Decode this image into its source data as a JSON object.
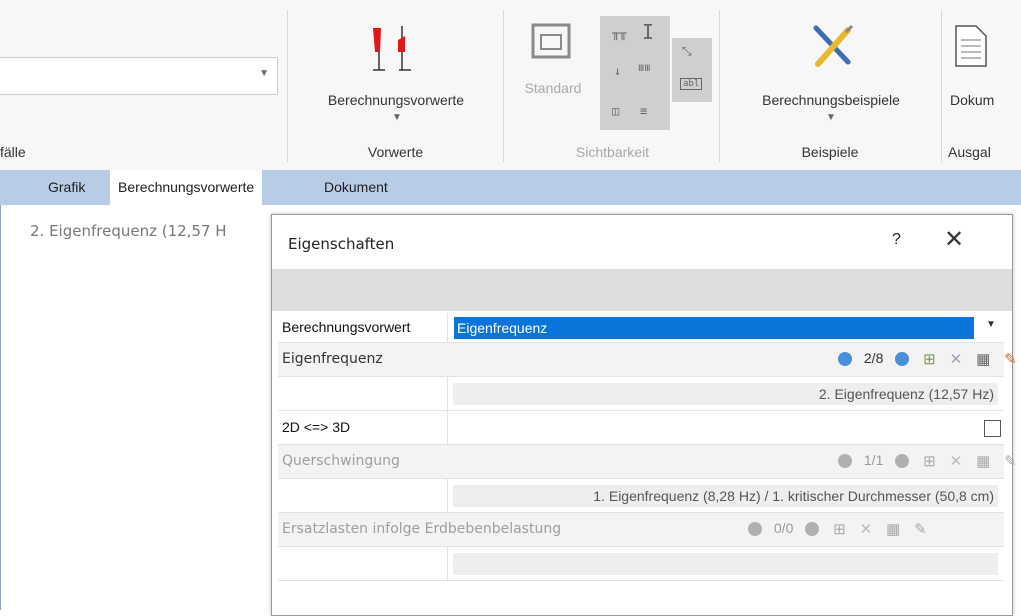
{
  "ribbon": {
    "combo": {
      "value": ""
    },
    "left_group_label": "fälle",
    "berechnungsvorwerte_btn": "Berechnungsvorwerte",
    "vorwerte_label": "Vorwerte",
    "standard_btn": "Standard",
    "sichtbarkeit_label": "Sichtbarkeit",
    "berechnungsbeispiele_btn": "Berechnungsbeispiele",
    "beispiele_label": "Beispiele",
    "dokument_btn": "Dokum",
    "ausgabe_label": "Ausgal",
    "colors": {
      "flag_red": "#e01818",
      "accent_bar": "#b9cce6"
    }
  },
  "tabs": [
    {
      "label": "Grafik",
      "active": false
    },
    {
      "label": "Berechnungsvorwerte",
      "active": true
    },
    {
      "label": "Dokument",
      "active": false
    }
  ],
  "content": {
    "text": "2. Eigenfrequenz  (12,57 H"
  },
  "dialog": {
    "title": "Eigenschaften",
    "help": "?",
    "close": "✕",
    "rows": [
      {
        "label": "Berechnungsvorwert",
        "value": "Eigenfrequenz"
      },
      {
        "header": "Eigenfrequenz",
        "counter": "2/8"
      },
      {
        "value": "2. Eigenfrequenz  (12,57 Hz)"
      },
      {
        "label": "2D <=> 3D",
        "checked": false
      },
      {
        "header": "Querschwingung",
        "counter": "1/1"
      },
      {
        "value": "1. Eigenfrequenz  (8,28 Hz) / 1. kritischer Durchmesser  (50,8 cm)"
      },
      {
        "header": "Ersatzlasten infolge Erdbebenbelastung",
        "counter": "0/0"
      },
      {
        "value": ""
      }
    ]
  }
}
